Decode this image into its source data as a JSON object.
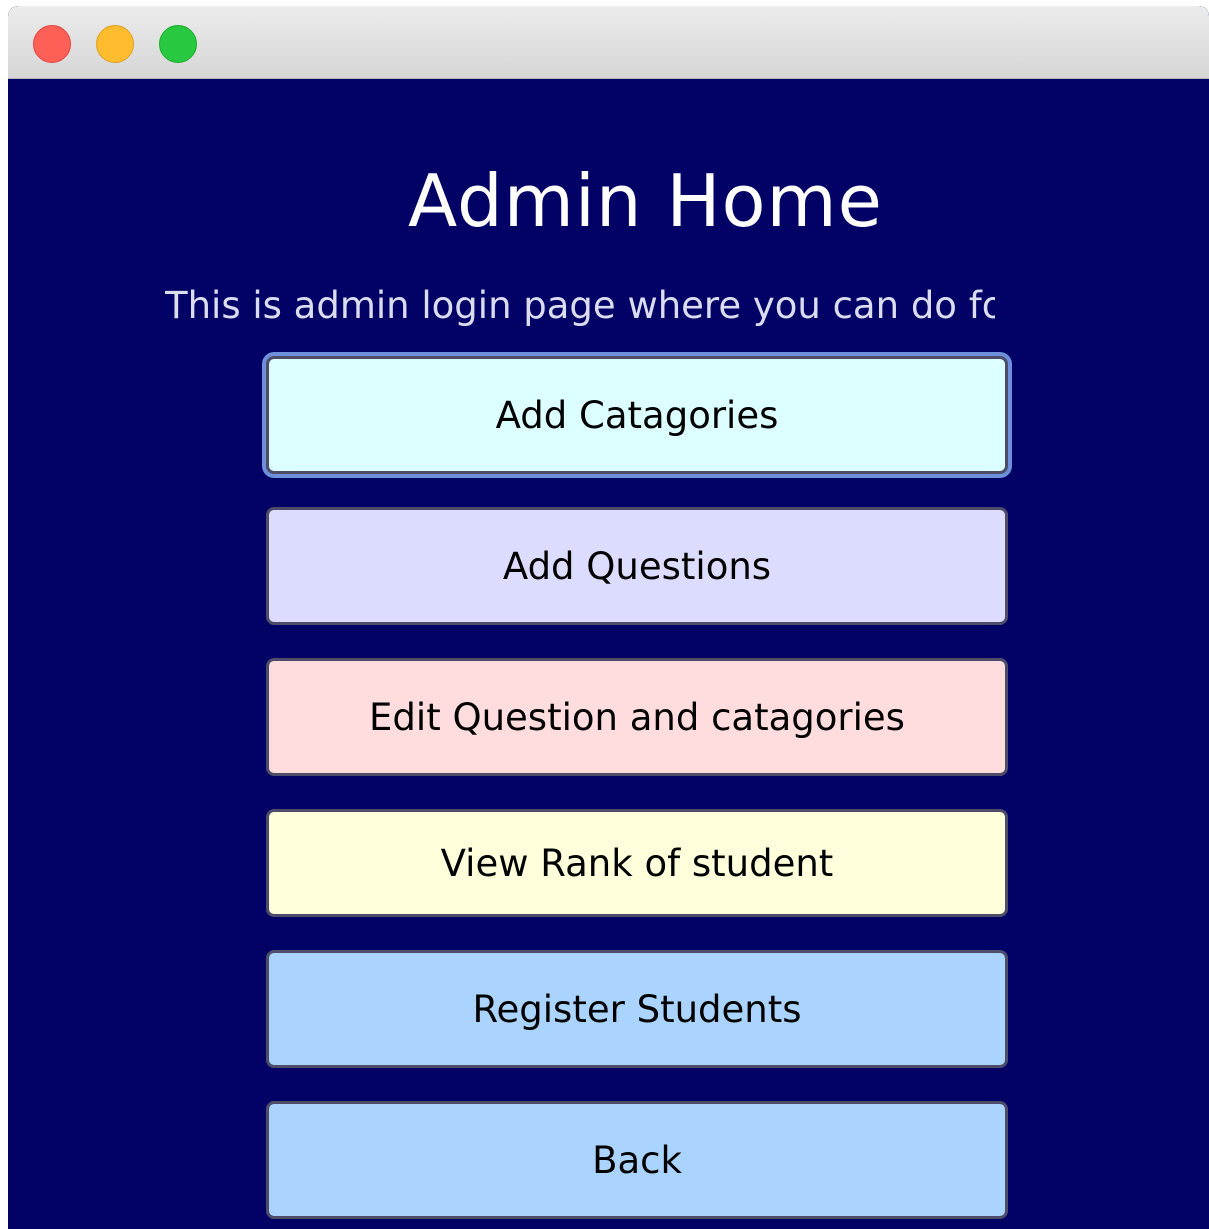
{
  "window": {
    "background_color": "#010166"
  },
  "header": {
    "title": "Admin Home",
    "subtitle": "This is admin login page where you can do fo"
  },
  "buttons": [
    {
      "label": "Add Catagories",
      "color": "#dcffff",
      "focused": true
    },
    {
      "label": "Add Questions",
      "color": "#dcddfe",
      "focused": false
    },
    {
      "label": "Edit Question and catagories",
      "color": "#ffdcdd",
      "focused": false
    },
    {
      "label": "View Rank of student",
      "color": "#ffffdc",
      "focused": false
    },
    {
      "label": "Register Students",
      "color": "#aad4fd",
      "focused": false
    },
    {
      "label": "Back",
      "color": "#aad4fd",
      "focused": false
    }
  ],
  "icons": {
    "close": "close-icon",
    "minimize": "minimize-icon",
    "maximize": "maximize-icon"
  }
}
